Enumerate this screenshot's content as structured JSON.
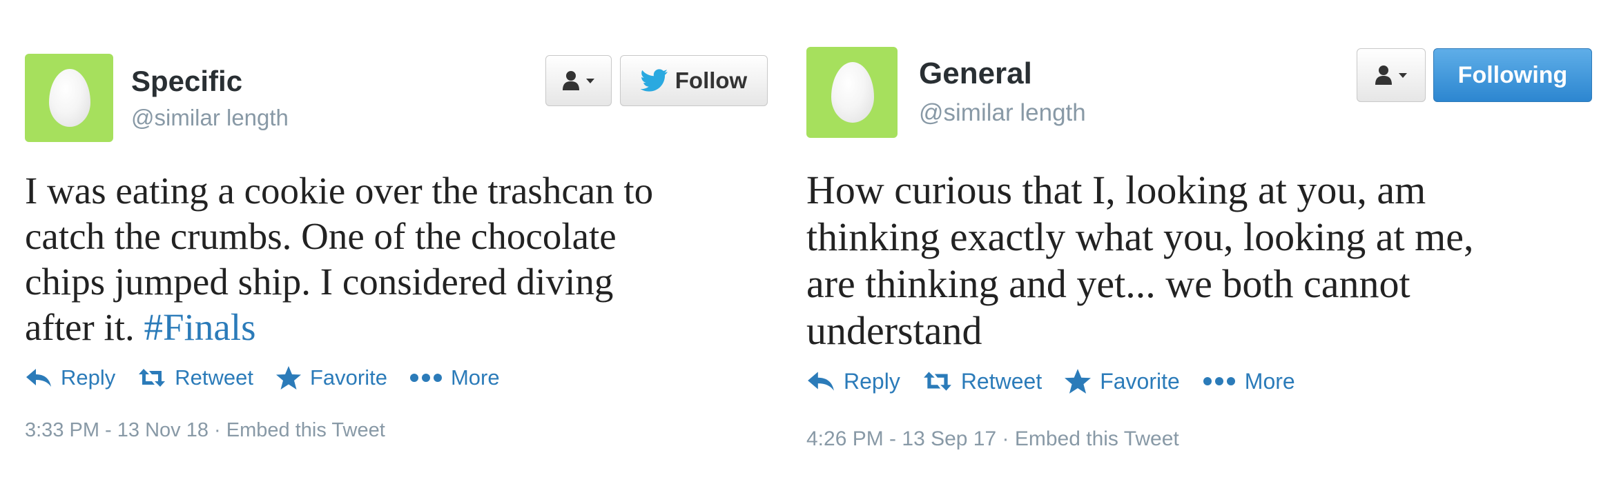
{
  "tweets": [
    {
      "name": "Specific",
      "handle": "@similar length",
      "follow_label": "Follow",
      "text_lines": [
        "I was eating a cookie over the trashcan to",
        "catch the crumbs. One of the chocolate",
        "chips jumped ship. I considered diving",
        "after it."
      ],
      "hashtag": "#Finals",
      "actions": {
        "reply": "Reply",
        "retweet": "Retweet",
        "favorite": "Favorite",
        "more": "More"
      },
      "timestamp": "3:33 PM - 13 Nov 18",
      "separator": "·",
      "embed": "Embed this Tweet"
    },
    {
      "name": "General",
      "handle": "@similar length",
      "follow_label": "Following",
      "text_lines": [
        "How curious that I, looking at you, am",
        "thinking exactly what you, looking at me,",
        "are thinking and yet... we both cannot",
        "understand"
      ],
      "actions": {
        "reply": "Reply",
        "retweet": "Retweet",
        "favorite": "Favorite",
        "more": "More"
      },
      "timestamp": "4:26 PM - 13 Sep 17",
      "separator": "·",
      "embed": "Embed this Tweet"
    }
  ],
  "colors": {
    "avatar_bg": "#a6e05d",
    "link": "#2b7bb9",
    "muted": "#8899a6",
    "following_bg": "#2c86d0",
    "twitter_bird": "#2aa9e0"
  },
  "icons": [
    "egg-avatar",
    "user-icon",
    "caret-down-icon",
    "twitter-bird-icon",
    "reply-icon",
    "retweet-icon",
    "star-icon",
    "more-dots-icon"
  ]
}
